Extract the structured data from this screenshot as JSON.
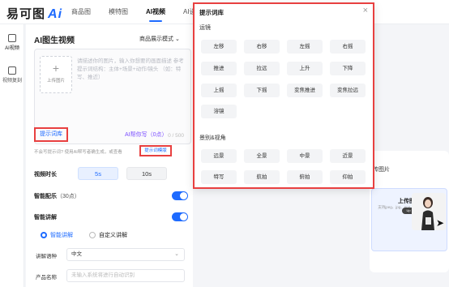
{
  "header": {
    "logo_text": "易可图",
    "logo_mark": "Ai",
    "nav": [
      "商品图",
      "模特图",
      "AI视频",
      "AI设"
    ]
  },
  "sidebar": {
    "items": [
      {
        "label": "AI视频"
      },
      {
        "label": "视频复刻"
      }
    ]
  },
  "panel": {
    "title": "AI图生视频",
    "mode_select": "商品展示模式 ⌄",
    "upload_label": "上传图片",
    "prompt_placeholder": "请描述你的图片，输入你想要的画面描述 参考提示词结构：主体+场景+动作/镜头 （如：特写、推近）",
    "char_count": "0 / 500",
    "prompt_lib_link": "提示词库",
    "ai_help": "AI帮你写（0点）",
    "hint_text": "不会写提示词? 使用AI帮写者确生成，或查看",
    "hint_link": "提示词模版",
    "duration_label": "视频时长",
    "duration_options": [
      "5s",
      "10s"
    ],
    "music_label": "智能配乐",
    "music_cost": "（30点）",
    "narration_label": "智能讲解",
    "narration_modes": [
      "智能讲解",
      "自定义讲解"
    ],
    "lang_label": "讲解语种",
    "lang_value": "中文",
    "product_label": "产品名称",
    "product_placeholder": "未输入系统将进行自动识别"
  },
  "popup": {
    "title": "提示词库",
    "close_glyph": "×",
    "section1": {
      "title": "运镜",
      "chips": [
        "左移",
        "右移",
        "左摇",
        "右摇",
        "推进",
        "拉远",
        "上升",
        "下降",
        "上摇",
        "下摇",
        "变焦推进",
        "变焦拉远",
        "溶镜"
      ]
    },
    "section2": {
      "title": "景别&视角",
      "chips": [
        "远景",
        "全景",
        "中景",
        "近景",
        "特写",
        "航拍",
        "俯拍",
        "仰拍"
      ]
    }
  },
  "right": {
    "preview_label": "传图片",
    "upload_card_title": "上传图片",
    "upload_card_sub": "支持jpeg、jpg、png、webp、bmp格式",
    "pill_text": "Up"
  }
}
